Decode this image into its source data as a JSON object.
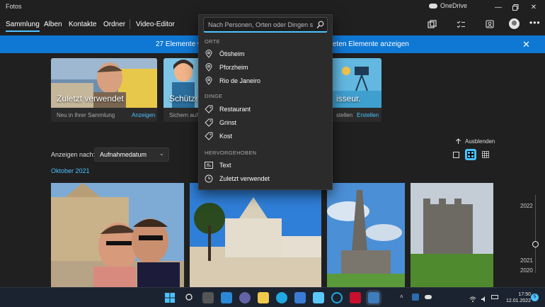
{
  "app": {
    "title": "Fotos"
  },
  "onedrive": {
    "label": "OneDrive"
  },
  "nav": {
    "items": [
      "Sammlung",
      "Alben",
      "Kontakte",
      "Ordner",
      "Video-Editor"
    ],
    "active": "Sammlung"
  },
  "banner": {
    "text_left": "27 Elemente wu",
    "text_right": "eten Elemente anzeigen"
  },
  "cards": [
    {
      "title": "Zuletzt verwendet",
      "subtitle": "Neu in Ihrer Sammlung",
      "link": "Anzeigen"
    },
    {
      "title": "Schützer",
      "subtitle": "Sichern auf"
    },
    {
      "title": "isseur.",
      "subtitle": "stellen",
      "link": "Erstellen"
    }
  ],
  "sort": {
    "label": "Anzeigen nach:",
    "value": "Aufnahmedatum"
  },
  "month": "Oktober 2021",
  "hide_label": "Ausblenden",
  "timeline": {
    "years": [
      "2022",
      "2021",
      "2020"
    ]
  },
  "search": {
    "placeholder": "Nach Personen, Orten oder Dingen suc",
    "sections": [
      {
        "heading": "ORTE",
        "items": [
          {
            "label": "Ötisheim",
            "icon": "location-pin-icon"
          },
          {
            "label": "Pforzheim",
            "icon": "location-pin-icon"
          },
          {
            "label": "Rio de Janeiro",
            "icon": "location-pin-icon"
          }
        ]
      },
      {
        "heading": "DINGE",
        "items": [
          {
            "label": "Restaurant",
            "icon": "tag-icon"
          },
          {
            "label": "Grinst",
            "icon": "tag-icon"
          },
          {
            "label": "Kost",
            "icon": "tag-icon"
          }
        ]
      },
      {
        "heading": "HERVORGEHOBEN",
        "items": [
          {
            "label": "Text",
            "icon": "text-scan-icon"
          },
          {
            "label": "Zuletzt verwendet",
            "icon": "clock-icon"
          }
        ]
      }
    ]
  },
  "taskbar": {
    "clock_time": "17:50",
    "clock_date": "12.01.2022",
    "notification_count": "5"
  },
  "colors": {
    "accent": "#4cc2ff",
    "banner": "#0f78d4",
    "background": "#202020",
    "menu": "#2b2b2b"
  }
}
